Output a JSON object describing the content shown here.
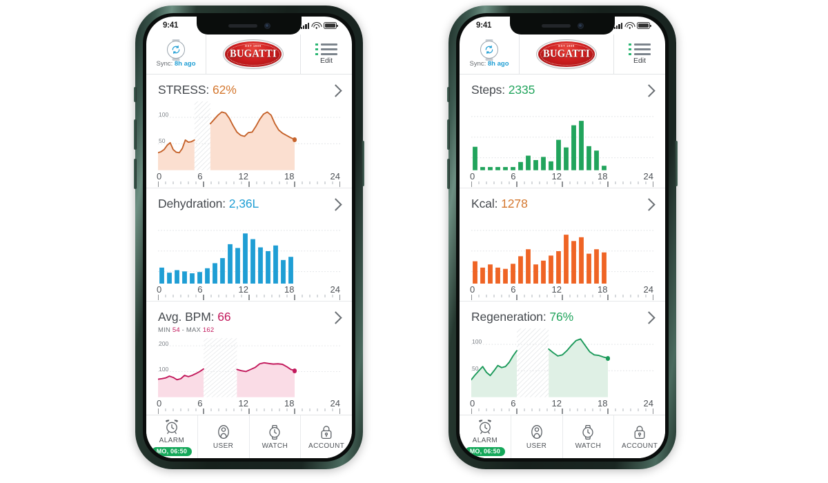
{
  "phones": [
    {
      "id": "left",
      "status_bar": {
        "time": "9:41",
        "signal": "cellular-signal-icon",
        "wifi": "wifi-icon",
        "battery": "battery-icon"
      },
      "header": {
        "sync_icon": "watch-sync-icon",
        "sync_prefix": "Sync: ",
        "sync_value": "8h ago",
        "logo_text": "BUGATTI",
        "logo_top_text": "EST 1909",
        "edit_icon": "list-menu-icon",
        "edit_label": "Edit"
      },
      "cards": [
        {
          "name": "stress",
          "title": "STRESS: ",
          "value": "62%",
          "value_color": "#d4772e",
          "subtitle": null,
          "chart_ref": 0
        },
        {
          "name": "dehydration",
          "title": "Dehydration: ",
          "value": "2,36L",
          "value_color": "#1f9ed4",
          "subtitle": null,
          "chart_ref": 1
        },
        {
          "name": "avg-bpm",
          "title": "Avg. BPM: ",
          "value": "66",
          "value_color": "#c2185b",
          "subtitle_parts": [
            "MIN ",
            "54",
            " - MAX ",
            "162"
          ],
          "chart_ref": 2
        }
      ]
    },
    {
      "id": "right",
      "status_bar": {
        "time": "9:41",
        "signal": "cellular-signal-icon",
        "wifi": "wifi-icon",
        "battery": "battery-icon"
      },
      "header": {
        "sync_icon": "watch-sync-icon",
        "sync_prefix": "Sync: ",
        "sync_value": "8h ago",
        "logo_text": "BUGATTI",
        "logo_top_text": "EST 1909",
        "edit_icon": "list-menu-icon",
        "edit_label": "Edit"
      },
      "cards": [
        {
          "name": "steps",
          "title": "Steps: ",
          "value": "2335",
          "value_color": "#21a45c",
          "subtitle": null,
          "chart_ref": 3
        },
        {
          "name": "kcal",
          "title": "Kcal: ",
          "value": "1278",
          "value_color": "#d4772e",
          "subtitle": null,
          "chart_ref": 4
        },
        {
          "name": "regeneration",
          "title": "Regeneration: ",
          "value": "76%",
          "value_color": "#21a45c",
          "subtitle": null,
          "chart_ref": 5
        }
      ]
    }
  ],
  "tabbar": {
    "tabs": [
      {
        "icon": "alarm-clock-icon",
        "label": "ALARM",
        "badge": "MO, 06:50"
      },
      {
        "icon": "user-icon",
        "label": "USER",
        "badge": null
      },
      {
        "icon": "watch-icon",
        "label": "WATCH",
        "badge": null
      },
      {
        "icon": "lock-icon",
        "label": "ACCOUNT",
        "badge": null
      }
    ]
  },
  "axis_labels": [
    "0",
    "6",
    "12",
    "18",
    "24"
  ],
  "chart_data": [
    {
      "type": "area",
      "title": "STRESS",
      "ylabel": "",
      "xlabel": "hour",
      "ylim": [
        0,
        130
      ],
      "xlim": [
        0,
        24
      ],
      "y_ticks": [
        50,
        100
      ],
      "tick_labels": [
        "50",
        "100"
      ],
      "x_ticks": [
        0,
        6,
        12,
        18,
        24
      ],
      "tick_labels_x": [
        "0",
        "6",
        "12",
        "18",
        "24"
      ],
      "grid": true,
      "color": "#c5622a",
      "fill": "#fbdfd0",
      "gap_from": 4.8,
      "gap_to": 6.9,
      "last_point": {
        "x": 18.0,
        "y": 58
      },
      "x": [
        0.0,
        0.4,
        0.8,
        1.2,
        1.6,
        2.0,
        2.4,
        2.8,
        3.2,
        3.6,
        4.0,
        4.4,
        4.8
      ],
      "values": [
        33,
        35,
        39,
        47,
        52,
        39,
        34,
        33,
        41,
        57,
        53,
        54,
        57
      ],
      "x2": [
        6.9,
        7.4,
        7.9,
        8.4,
        8.9,
        9.4,
        9.9,
        10.4,
        10.9,
        11.4,
        11.9,
        12.4,
        12.9,
        13.4,
        13.9,
        14.4,
        14.9,
        15.4,
        15.9,
        16.4,
        16.9,
        17.4,
        18.0
      ],
      "values2": [
        88,
        96,
        104,
        110,
        108,
        98,
        84,
        72,
        66,
        64,
        71,
        72,
        83,
        96,
        106,
        110,
        104,
        88,
        76,
        70,
        66,
        62,
        58
      ]
    },
    {
      "type": "bar",
      "title": "Dehydration",
      "ylabel": "",
      "xlabel": "hour",
      "xlim": [
        0,
        24
      ],
      "ylim": [
        0,
        100
      ],
      "grid": true,
      "color": "#1f9ed4",
      "categories": [
        0,
        1,
        2,
        3,
        4,
        5,
        6,
        7,
        8,
        9,
        10,
        11,
        12,
        13,
        14,
        15,
        16,
        17
      ],
      "values": [
        26,
        18,
        22,
        20,
        17,
        19,
        25,
        33,
        41,
        63,
        57,
        80,
        71,
        58,
        52,
        61,
        38,
        43
      ]
    },
    {
      "type": "area",
      "title": "Avg. BPM",
      "ylabel": "",
      "xlabel": "hour",
      "ylim": [
        0,
        230
      ],
      "xlim": [
        0,
        24
      ],
      "y_ticks": [
        100,
        200
      ],
      "tick_labels": [
        "100",
        "200"
      ],
      "grid": true,
      "color": "#c2185b",
      "fill": "#fadce6",
      "gap_from": 6.0,
      "gap_to": 10.4,
      "last_point": {
        "x": 18.0,
        "y": 104
      },
      "x": [
        0.0,
        0.5,
        1.0,
        1.5,
        2.0,
        2.5,
        3.0,
        3.5,
        4.0,
        4.5,
        5.0,
        5.5,
        6.0
      ],
      "values": [
        70,
        72,
        75,
        82,
        77,
        68,
        72,
        85,
        80,
        85,
        92,
        100,
        110
      ],
      "x2": [
        10.4,
        11.0,
        11.6,
        12.2,
        12.8,
        13.4,
        14.0,
        14.6,
        15.2,
        15.8,
        16.4,
        17.0,
        17.5,
        18.0
      ],
      "values2": [
        108,
        103,
        100,
        108,
        116,
        130,
        134,
        131,
        129,
        130,
        128,
        118,
        108,
        104
      ]
    },
    {
      "type": "bar",
      "title": "Steps",
      "ylabel": "",
      "xlabel": "hour",
      "xlim": [
        0,
        24
      ],
      "ylim": [
        0,
        100
      ],
      "grid": true,
      "color": "#21a45c",
      "categories": [
        0,
        1,
        2,
        3,
        4,
        5,
        6,
        7,
        8,
        9,
        10,
        11,
        12,
        13,
        14,
        15,
        16,
        17
      ],
      "values": [
        37,
        5,
        5,
        5,
        5,
        5,
        13,
        23,
        16,
        21,
        14,
        48,
        36,
        71,
        78,
        38,
        31,
        7
      ]
    },
    {
      "type": "bar",
      "title": "Kcal",
      "ylabel": "",
      "xlabel": "hour",
      "xlim": [
        0,
        24
      ],
      "ylim": [
        0,
        100
      ],
      "grid": true,
      "color": "#ef6425",
      "categories": [
        0,
        1,
        2,
        3,
        4,
        5,
        6,
        7,
        8,
        9,
        10,
        11,
        12,
        13,
        14,
        15,
        16,
        17
      ],
      "values": [
        36,
        26,
        31,
        26,
        24,
        32,
        44,
        55,
        31,
        37,
        45,
        52,
        78,
        68,
        74,
        48,
        55,
        50
      ]
    },
    {
      "type": "area",
      "title": "Regeneration",
      "ylabel": "",
      "xlabel": "hour",
      "ylim": [
        0,
        130
      ],
      "xlim": [
        0,
        24
      ],
      "y_ticks": [
        50,
        100
      ],
      "tick_labels": [
        "50",
        "100"
      ],
      "grid": true,
      "color": "#1a9959",
      "fill": "#dff0e5",
      "gap_from": 6.0,
      "gap_to": 10.2,
      "last_point": {
        "x": 18.0,
        "y": 74
      },
      "x": [
        0.0,
        0.5,
        1.0,
        1.5,
        2.0,
        2.5,
        3.0,
        3.5,
        4.0,
        4.5,
        5.0,
        5.5,
        6.0
      ],
      "values": [
        33,
        42,
        50,
        58,
        47,
        41,
        50,
        60,
        56,
        58,
        66,
        78,
        88
      ],
      "x2": [
        10.2,
        10.8,
        11.4,
        12.0,
        12.6,
        13.2,
        13.8,
        14.4,
        15.0,
        15.6,
        16.2,
        16.8,
        17.4,
        18.0
      ],
      "values2": [
        91,
        84,
        78,
        80,
        88,
        98,
        107,
        110,
        98,
        86,
        80,
        79,
        76,
        74
      ]
    }
  ]
}
